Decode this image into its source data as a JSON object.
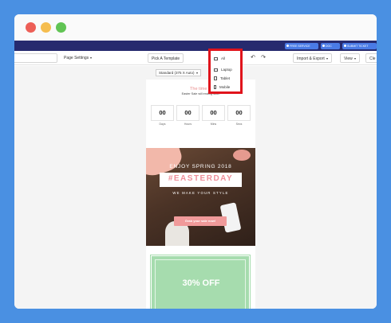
{
  "nav": {
    "buttons": [
      {
        "label": "FREE SERVICE"
      },
      {
        "label": "DOC"
      },
      {
        "label": "SUBMIT TICKET"
      }
    ]
  },
  "toolbar": {
    "page_settings": "Page Settings",
    "pick_template": "Pick A Template",
    "import_export": "Import & Export",
    "view": "View",
    "clear": "Cle"
  },
  "device_menu": {
    "items": [
      "All",
      "Laptop",
      "Tablet",
      "Mobile"
    ],
    "highlight_color": "#e0141c"
  },
  "size_select": "Standard (375 X Auto)",
  "email": {
    "countdown_title": "The time is",
    "countdown_sub": "Easter Sale will ending soon",
    "countdown": [
      {
        "value": "00",
        "label": "Days"
      },
      {
        "value": "00",
        "label": "Hours"
      },
      {
        "value": "00",
        "label": "Mins"
      },
      {
        "value": "00",
        "label": "Secs"
      }
    ],
    "hero_line1": "ENJOY SPRING 2018",
    "hero_tag": "#EASTERDAY",
    "hero_line2": "WE MAKE YOUR STYLE",
    "hero_button": "Grab your sale now!",
    "offer": "30% OFF"
  },
  "colors": {
    "background": "#4a90e2",
    "navbar": "#262a6e",
    "accent_pink": "#f09a9a",
    "offer_green": "#a6dcae"
  }
}
